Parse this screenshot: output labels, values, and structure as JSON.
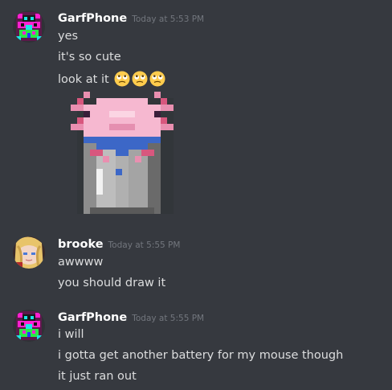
{
  "messages": [
    {
      "username": "GarfPhone",
      "timestamp": "Today at 5:53 PM",
      "lines": [
        "yes",
        "it's so cute",
        "look at it"
      ],
      "emoji": [
        "rolling-eyes-emoji",
        "rolling-eyes-emoji",
        "rolling-eyes-emoji"
      ],
      "attachment": "axolotl-in-bucket-pixel-art"
    },
    {
      "username": "brooke",
      "timestamp": "Today at 5:55 PM",
      "lines": [
        "awwww",
        "you should draw it"
      ]
    },
    {
      "username": "GarfPhone",
      "timestamp": "Today at 5:55 PM",
      "lines": [
        "i will",
        "i gotta get another battery for my mouse though",
        "it just ran out"
      ]
    }
  ],
  "colors": {
    "background": "#36393f",
    "username": "#ffffff",
    "timestamp": "#72767d",
    "text": "#dcddde"
  }
}
